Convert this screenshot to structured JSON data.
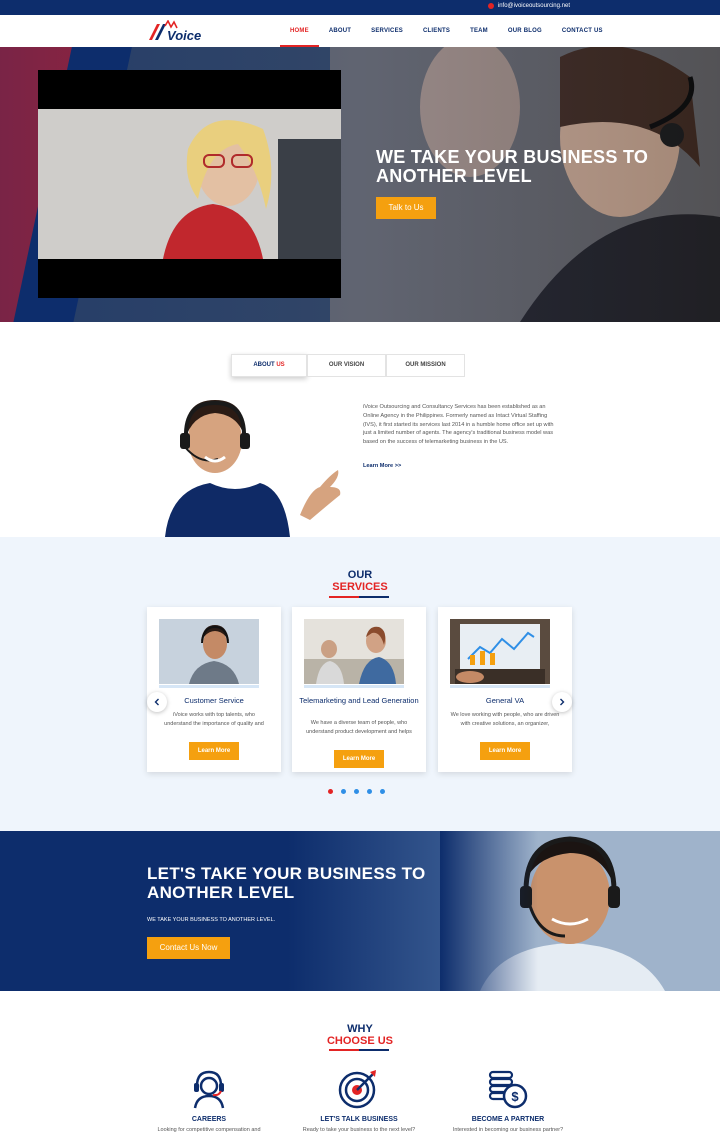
{
  "topbar": {
    "email": "info@ivoiceoutsourcing.net",
    "email_icon": "mail-icon"
  },
  "header": {
    "logo_text": "iVoice",
    "nav": [
      {
        "label": "HOME",
        "active": true
      },
      {
        "label": "ABOUT"
      },
      {
        "label": "SERVICES"
      },
      {
        "label": "CLIENTS"
      },
      {
        "label": "TEAM"
      },
      {
        "label": "OUR BLOG"
      },
      {
        "label": "CONTACT US"
      }
    ]
  },
  "hero": {
    "title": "WE TAKE YOUR BUSINESS TO ANOTHER LEVEL",
    "button": "Talk to Us"
  },
  "about": {
    "tabs": [
      {
        "label_a": "ABOUT",
        "label_b": "US"
      },
      {
        "label": "OUR VISION"
      },
      {
        "label": "OUR MISSION"
      }
    ],
    "text": "iVoice Outsourcing and Consultancy Services has been established as an Online Agency in the Philippines. Formerly named as Intact Virtual Staffing (IVS), it first started its services last 2014 in a humble home office set up with just a limited number of agents. The agency's traditional business model was based on the success of telemarketing business in the US.",
    "link": "Learn More >>"
  },
  "services": {
    "title_1": "OUR",
    "title_2": "SERVICES",
    "cards": [
      {
        "title": "Customer Service",
        "desc": "iVoice works with top talents, who understand the importance of quality and integrity and has a passion for",
        "button": "Learn More"
      },
      {
        "title": "Telemarketing and Lead Generation",
        "desc": "We have a diverse team of people, who understand product development and helps provide strategic solutions to",
        "button": "Learn More"
      },
      {
        "title": "General VA",
        "desc": "We love working with people, who are driven with creative solutions, an organizer, problem solver and a people",
        "button": "Learn More"
      }
    ],
    "slide_count": 5,
    "active_slide": 1
  },
  "cta": {
    "title": "LET'S TAKE YOUR BUSINESS TO ANOTHER LEVEL",
    "subtitle": "WE TAKE YOUR BUSINESS TO ANOTHER LEVEL.",
    "button": "Contact Us Now"
  },
  "why": {
    "title_1": "WHY",
    "title_2": "CHOOSE US",
    "features": [
      {
        "icon": "headset-agent-icon",
        "title": "CAREERS",
        "desc": "Looking for competitive compensation and"
      },
      {
        "icon": "target-icon",
        "title": "LET'S TALK BUSINESS",
        "desc": "Ready to take your business to the next level?"
      },
      {
        "icon": "coins-icon",
        "title": "BECOME A PARTNER",
        "desc": "Interested in becoming our business partner?"
      }
    ]
  },
  "colors": {
    "navy": "#0d2d6c",
    "red": "#e32424",
    "orange": "#f5a00f",
    "light_bg": "#eff5fc"
  }
}
